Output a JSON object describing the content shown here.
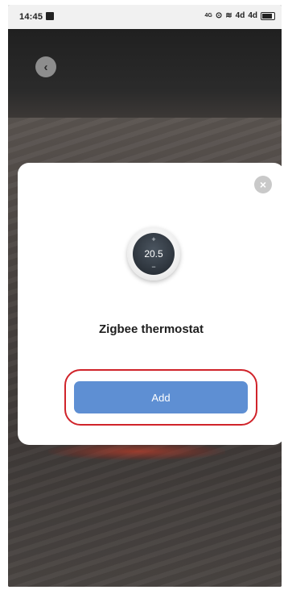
{
  "status_bar": {
    "time": "14:45",
    "network_label": "4G",
    "signal_1": "4d",
    "signal_2": "4d"
  },
  "header": {
    "back_icon_glyph": "‹"
  },
  "modal": {
    "close_icon_glyph": "×",
    "device": {
      "plus": "+",
      "temperature": "20.5",
      "minus": "−"
    },
    "device_name": "Zigbee thermostat",
    "add_label": "Add"
  },
  "colors": {
    "primary_button": "#5e8fd3",
    "highlight_outline": "#d0232a"
  }
}
